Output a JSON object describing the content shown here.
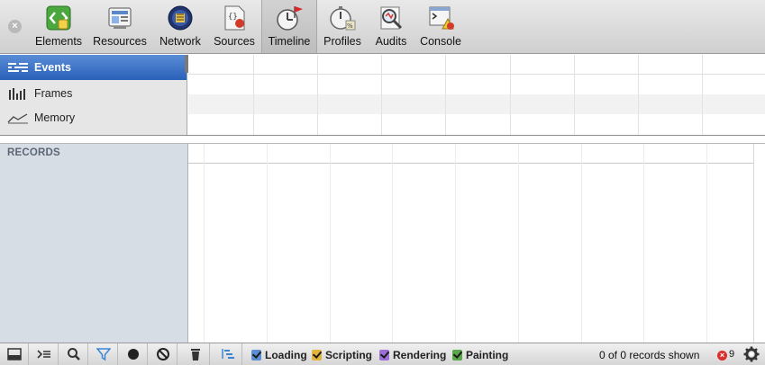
{
  "toolbar": {
    "tabs": [
      {
        "label": "Elements",
        "icon": "elements-icon"
      },
      {
        "label": "Resources",
        "icon": "resources-icon"
      },
      {
        "label": "Network",
        "icon": "network-icon"
      },
      {
        "label": "Sources",
        "icon": "sources-icon"
      },
      {
        "label": "Timeline",
        "icon": "timeline-icon",
        "selected": true
      },
      {
        "label": "Profiles",
        "icon": "profiles-icon"
      },
      {
        "label": "Audits",
        "icon": "audits-icon"
      },
      {
        "label": "Console",
        "icon": "console-icon"
      }
    ]
  },
  "overview": {
    "items": [
      {
        "label": "Events",
        "icon": "events-icon",
        "selected": true
      },
      {
        "label": "Frames",
        "icon": "frames-icon"
      },
      {
        "label": "Memory",
        "icon": "memory-icon"
      }
    ]
  },
  "records": {
    "title": "RECORDS"
  },
  "statusbar": {
    "filters": [
      {
        "label": "Loading",
        "color": "#5a8fd6"
      },
      {
        "label": "Scripting",
        "color": "#e3b43b"
      },
      {
        "label": "Rendering",
        "color": "#9b6fd6"
      },
      {
        "label": "Painting",
        "color": "#5aa64a"
      }
    ],
    "record_count": "0 of 0 records shown",
    "error_count": "9",
    "error_symbol": "×"
  },
  "colors": {
    "selected_blue": "#2a62b9",
    "records_sidebar": "#d6dde5"
  }
}
